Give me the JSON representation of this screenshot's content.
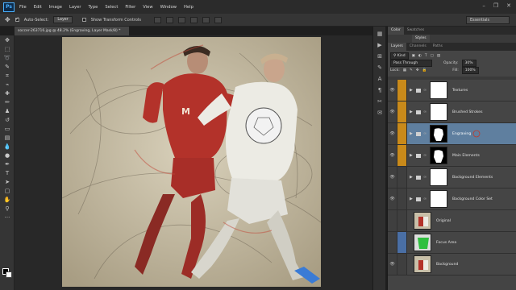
{
  "app": {
    "logo": "Ps",
    "menu": [
      "File",
      "Edit",
      "Image",
      "Layer",
      "Type",
      "Select",
      "Filter",
      "View",
      "Window",
      "Help"
    ],
    "window_controls": [
      "–",
      "❐",
      "✕"
    ]
  },
  "options": {
    "auto_select_label": "Auto-Select:",
    "auto_select_value": "Layer",
    "transform_label": "Show Transform Controls",
    "workspace": "Essentials"
  },
  "document": {
    "tab_title": "soccer-263716.jpg @ 48.2% (Engraving, Layer Mask/8) *"
  },
  "panels": {
    "top_tabs": [
      "Color",
      "Swatches"
    ],
    "styles_tab": "Styles",
    "layer_tabs": [
      "Layers",
      "Channels",
      "Paths"
    ],
    "kind_label": "Kind",
    "blend_mode": "Pass Through",
    "opacity_label": "Opacity:",
    "opacity_value": "30%",
    "lock_label": "Lock:",
    "fill_label": "Fill:",
    "fill_value": "100%"
  },
  "layers": [
    {
      "name": "Textures",
      "type": "group",
      "mask": "white",
      "tag": "orange",
      "selected": false
    },
    {
      "name": "Brushed Strokes",
      "type": "group",
      "mask": "white",
      "tag": "orange",
      "selected": false
    },
    {
      "name": "Engraving",
      "type": "group",
      "mask": "silhouette",
      "tag": "orange",
      "selected": true
    },
    {
      "name": "Main Elements",
      "type": "group",
      "mask": "silhouette",
      "tag": "orange",
      "selected": false
    },
    {
      "name": "Background Elements",
      "type": "group",
      "mask": "white",
      "tag": "none",
      "selected": false
    },
    {
      "name": "Background Color Set",
      "type": "group",
      "mask": "white",
      "tag": "none",
      "selected": false
    },
    {
      "name": "Original",
      "type": "layer",
      "mask": "photo",
      "tag": "none",
      "selected": false
    },
    {
      "name": "Focus Area",
      "type": "layer",
      "mask": "green",
      "tag": "blue",
      "selected": false
    },
    {
      "name": "Background",
      "type": "layer",
      "mask": "photo",
      "tag": "none",
      "selected": false
    }
  ],
  "colors": {
    "orange_tag": "#c98a1a",
    "blue_tag": "#4a6fa5",
    "selected_row": "#5f7f9f",
    "accent_red": "#c0392b"
  }
}
